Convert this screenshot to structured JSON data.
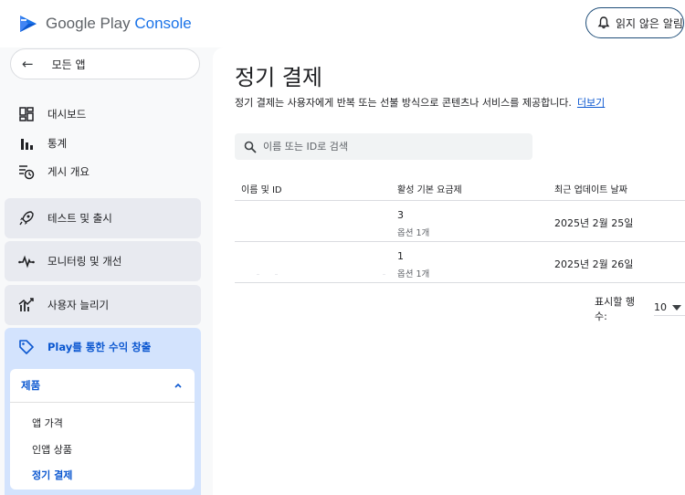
{
  "header": {
    "logo_google_play": "Google Play",
    "logo_console": "Console",
    "notifications_label": "읽지 않은 알림"
  },
  "sidebar": {
    "back_label": "모든 앱",
    "items": [
      {
        "label": "대시보드",
        "icon": "dashboard-icon"
      },
      {
        "label": "통계",
        "icon": "bar-chart-icon"
      },
      {
        "label": "게시 개요",
        "icon": "publishing-overview-icon"
      }
    ],
    "cards": [
      {
        "label": "테스트 및 출시",
        "icon": "rocket-icon"
      },
      {
        "label": "모니터링 및 개선",
        "icon": "pulse-icon"
      },
      {
        "label": "사용자 늘리기",
        "icon": "growth-icon"
      }
    ],
    "monetize": {
      "label": "Play를 통한 수익 창출",
      "icon": "tag-icon",
      "section_label": "제품",
      "sub_items": [
        {
          "label": "앱 가격"
        },
        {
          "label": "인앱 상품"
        },
        {
          "label": "정기 결제",
          "active": true
        }
      ]
    }
  },
  "main": {
    "title": "정기 결제",
    "description": "정기 결제는 사용자에게 반복 또는 선불 방식으로 콘텐츠나 서비스를 제공합니다.",
    "learn_more": "더보기",
    "search_placeholder": "이름 또는 ID로 검색",
    "table": {
      "headers": [
        "이름 및 ID",
        "활성 기본 요금제",
        "최근 업데이트 날짜"
      ],
      "rows": [
        {
          "active_plans": "3",
          "options": "옵션 1개",
          "updated": "2025년 2월 25일"
        },
        {
          "active_plans": "1",
          "options": "옵션 1개",
          "updated": "2025년 2월 26일"
        }
      ]
    },
    "pagination": {
      "rows_per_page_label": "표시할 행 수:",
      "rows_per_page_value": "10"
    }
  },
  "colors": {
    "accent": "#0b57d0",
    "nav_group_bg": "#d3e3fd",
    "card_bg": "#e8eaf0"
  }
}
